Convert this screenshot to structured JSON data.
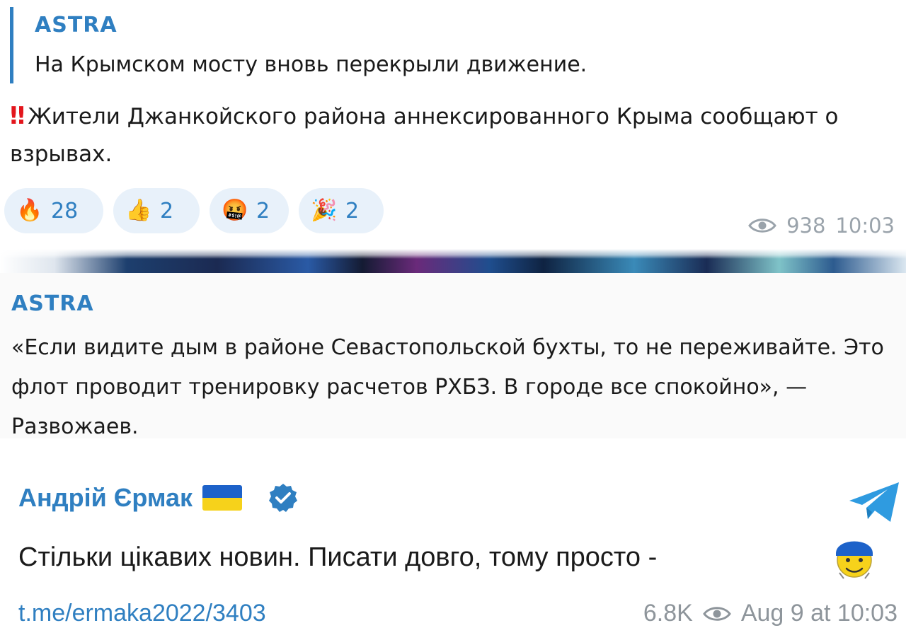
{
  "message1": {
    "reply": {
      "author": "ASTRA",
      "text": "На Крымском мосту вновь перекрыли движение."
    },
    "bangs": "‼",
    "body": "Жители Джанкойского района аннексированного Крыма сообщают о взрывах.",
    "reactions": [
      {
        "emoji": "🔥",
        "icon": "fire-emoji",
        "count": "28"
      },
      {
        "emoji": "👍",
        "icon": "thumbs-up-emoji",
        "count": "2"
      },
      {
        "emoji": "🤬",
        "icon": "cursing-face-emoji",
        "count": "2"
      },
      {
        "emoji": "🎉",
        "icon": "party-popper-emoji",
        "count": "2"
      }
    ],
    "views": "938",
    "time": "10:03"
  },
  "message2": {
    "author": "ASTRA",
    "text": "«Если видите дым в районе Севастопольской бухты, то не переживайте. Это флот проводит тренировку расчетов РХБЗ. В городе все спокойно», — Развожаев."
  },
  "message3": {
    "author": "Андрій Єрмак",
    "text": "Стільки цікавих новин. Писати довго, тому просто -",
    "link": "t.me/ermaka2022/3403",
    "views": "6.8K",
    "date": "Aug 9 at 10:03"
  },
  "colors": {
    "accent": "#2f7fc1",
    "meta": "#9aa3ab",
    "reaction_bg": "#e8f1fa",
    "flag_blue": "#1d62c9",
    "flag_yellow": "#f6d21b"
  }
}
